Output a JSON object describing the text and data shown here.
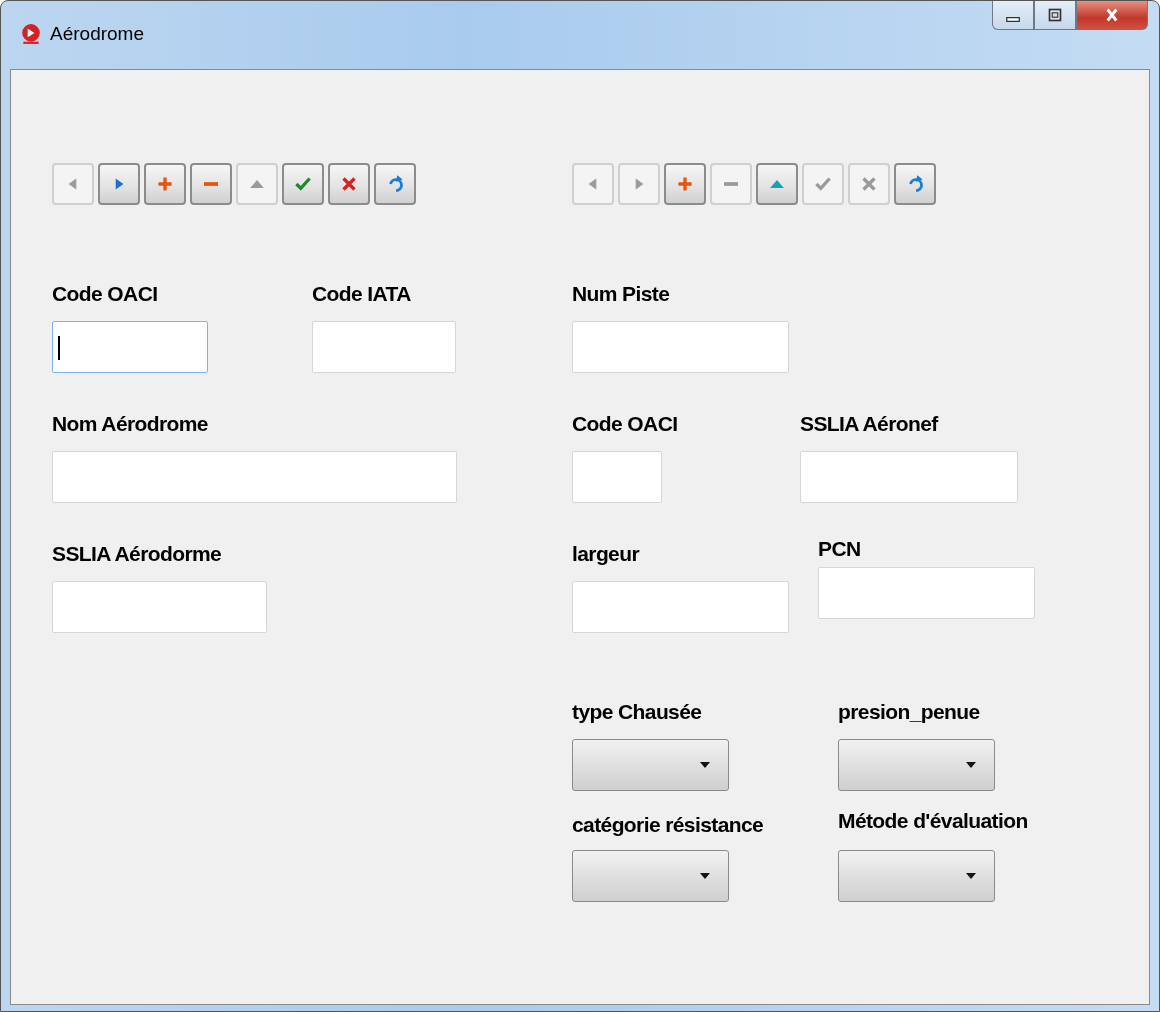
{
  "window": {
    "title": "Aérodrome"
  },
  "toolbars": [
    {
      "buttons": [
        {
          "kind": "prior",
          "disabled": true
        },
        {
          "kind": "next",
          "disabled": false
        },
        {
          "kind": "insert",
          "disabled": false
        },
        {
          "kind": "delete",
          "disabled": false
        },
        {
          "kind": "edit",
          "disabled": true
        },
        {
          "kind": "post",
          "disabled": false
        },
        {
          "kind": "cancel",
          "disabled": false
        },
        {
          "kind": "refresh",
          "disabled": false
        }
      ]
    },
    {
      "buttons": [
        {
          "kind": "prior",
          "disabled": true
        },
        {
          "kind": "next",
          "disabled": true
        },
        {
          "kind": "insert",
          "disabled": false
        },
        {
          "kind": "delete",
          "disabled": true
        },
        {
          "kind": "edit",
          "disabled": false
        },
        {
          "kind": "post",
          "disabled": true
        },
        {
          "kind": "cancel",
          "disabled": true
        },
        {
          "kind": "refresh",
          "disabled": false
        }
      ]
    }
  ],
  "aerodrome_form": {
    "fields": [
      {
        "label": "Code OACI",
        "kind": "text",
        "focused": true
      },
      {
        "label": "Code IATA",
        "kind": "text",
        "focused": false
      },
      {
        "label": "Nom Aérodrome",
        "kind": "text",
        "focused": false
      },
      {
        "label": "SSLIA Aérodorme",
        "kind": "text",
        "focused": false
      }
    ]
  },
  "runway_form": {
    "fields": [
      {
        "label": "Num Piste",
        "kind": "text"
      },
      {
        "label": "Code OACI",
        "kind": "text"
      },
      {
        "label": "SSLIA Aéronef",
        "kind": "text"
      },
      {
        "label": "largeur",
        "kind": "text"
      },
      {
        "label": "PCN",
        "kind": "text"
      },
      {
        "label": "type Chausée",
        "kind": "combo"
      },
      {
        "label": "presion_penue",
        "kind": "combo"
      },
      {
        "label": "catégorie résistance",
        "kind": "combo"
      },
      {
        "label": "Métode d'évaluation",
        "kind": "combo"
      }
    ]
  }
}
